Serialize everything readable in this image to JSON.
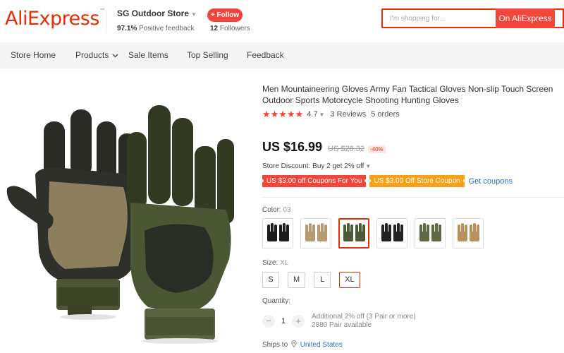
{
  "brand": {
    "logo_text": "AliExpress",
    "trademark": "™"
  },
  "store": {
    "name": "SG Outdoor Store",
    "feedback_value": "97.1%",
    "feedback_label": "Positive feedback",
    "follow_label": "+ Follow",
    "followers_count": "12",
    "followers_label": "Followers"
  },
  "search": {
    "placeholder": "I'm shopping for...",
    "button_label": "On AliExpress"
  },
  "nav": {
    "items": [
      {
        "label": "Store Home"
      },
      {
        "label": "Products"
      },
      {
        "label": "Sale Items"
      },
      {
        "label": "Top Selling"
      },
      {
        "label": "Feedback"
      }
    ]
  },
  "product": {
    "title": "Men Mountaineering Gloves Army Fan Tactical Gloves Non-slip Touch Screen Outdoor Sports Motorcycle Shooting Hunting Gloves",
    "rating": "4.7",
    "stars": "★★★★★",
    "reviews": "3 Reviews",
    "orders": "5 orders",
    "price": "US $16.99",
    "old_price": "US $28.32",
    "discount": "-40%",
    "store_discount": "Store Discount: Buy 2 get 2% off",
    "coupons": [
      {
        "label": "US $3.00 off Coupons For You"
      },
      {
        "label": "US $3.00 Off Store Coupon"
      }
    ],
    "get_coupons_label": "Get coupons",
    "color_label": "Color:",
    "color_value": "03",
    "color_swatches": [
      {
        "name": "black",
        "color": "#1c1c1c"
      },
      {
        "name": "tan-camo",
        "color": "#b59a74"
      },
      {
        "name": "green-camo",
        "color": "#4d5a37"
      },
      {
        "name": "black-fingerless",
        "color": "#222222"
      },
      {
        "name": "green-camo-fingerless",
        "color": "#5f6a44"
      },
      {
        "name": "tan-fingerless",
        "color": "#b8925c"
      }
    ],
    "selected_swatch": 2,
    "size_label": "Size:",
    "size_value": "XL",
    "sizes": [
      {
        "label": "S"
      },
      {
        "label": "M"
      },
      {
        "label": "L"
      },
      {
        "label": "XL"
      }
    ],
    "quantity_label": "Quantity:",
    "quantity": "1",
    "quantity_minus": "−",
    "quantity_plus": "+",
    "quantity_note_1": "Additional 2% off (3 Pair or more)",
    "quantity_note_2": "2880 Pair available",
    "ships_to_label": "Ships to",
    "ships_to_country": "United States"
  },
  "colors": {
    "accent": "#e62e04",
    "coupon_red": "#f2463b",
    "coupon_orange": "#f7a019",
    "link": "#2f6bb8",
    "glove_green": "#4d5a37"
  }
}
